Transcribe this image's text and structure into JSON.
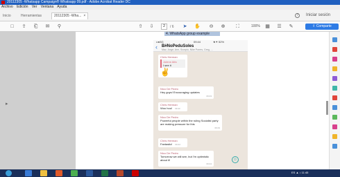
{
  "window": {
    "title": "20112305 -Whatsapp Campaign® Whatsapp 09.pdf - Adobe Acrobat Reader DC"
  },
  "menu": {
    "items": [
      "Archivo",
      "Edición",
      "Ver",
      "Ventana",
      "Ayuda"
    ]
  },
  "tabs": {
    "home": "Inicio",
    "tools": "Herramientas",
    "doc": "20112305 -Wha...",
    "close": "×"
  },
  "header": {
    "help": "?",
    "signin": "Iniciar sesión"
  },
  "toolbar": {
    "page_current": "2",
    "page_total": "/ 6",
    "zoom": "100%",
    "share_label": "Comparte"
  },
  "document": {
    "heading": "4. WhatsApp group example",
    "phone": {
      "status_left": "••●3G",
      "status_time": "09:44",
      "status_right": "★✦ 52%",
      "chat_name": "B#NoPeduSoles",
      "chat_sub": "Mav, Jorge, Ann, Scorpio, Nike Porres, Greg, ...",
      "messages": [
        {
          "sender": "Chris Herman",
          "quote_name": "Jolene Alfa",
          "quote_text": "I see it",
          "emoji": "✌",
          "time": ""
        },
        {
          "sender": "Nico De Pedro",
          "text": "Hey guys! Encouraging updates",
          "time": "09:43"
        },
        {
          "sender": "Chris Herman",
          "text": "Woo hoo!",
          "time": "09:43"
        },
        {
          "sender": "Nico De Pedro",
          "text": "Powerful people within the ruling Socialist party are making pressure for this",
          "time": "09:43"
        },
        {
          "sender": "Chris Herman",
          "text": "Fantastic!",
          "time": "09:44"
        },
        {
          "sender": "Nico De Pedro",
          "text": "Tomorrow we will see, but I'm optimistic about it!",
          "time": "09:44"
        }
      ]
    }
  },
  "taskbar": {
    "tray_text": "ES ▲ ♪ 11:45"
  },
  "colors": {
    "titlebar": "#1f5fbf",
    "share": "#2d7be5",
    "taskbar": "#1a2f5a",
    "chat_bg": "#ece5dd"
  }
}
